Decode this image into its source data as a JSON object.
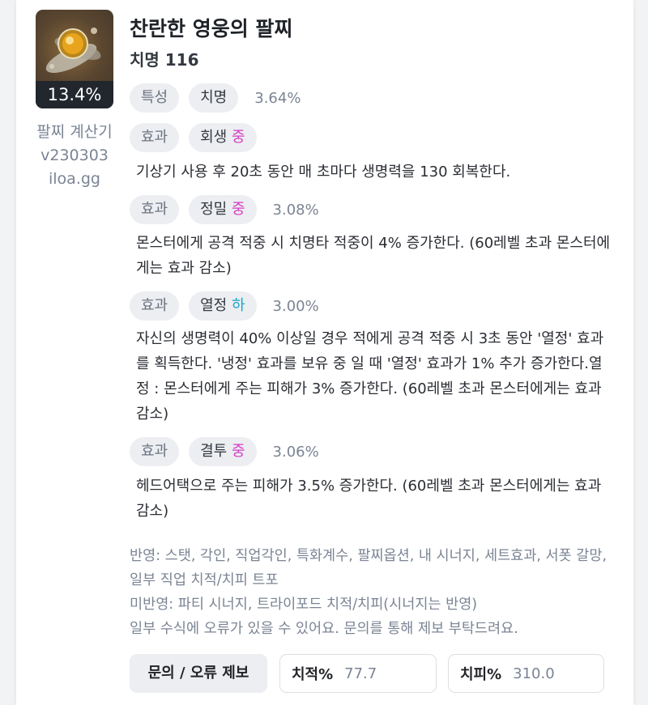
{
  "item": {
    "percent": "13.4%",
    "name": "찬란한 영웅의 팔찌",
    "stat": "치명 116"
  },
  "calculator": {
    "name": "팔찌 계산기",
    "version": "v230303",
    "site": "iloa.gg"
  },
  "trait": {
    "type_label": "특성",
    "stat_label": "치명",
    "value": "3.64%"
  },
  "effects": [
    {
      "type_label": "효과",
      "name": "회생",
      "grade": "중",
      "value": "",
      "description": "기상기 사용 후 20초 동안 매 초마다 생명력을 130 회복한다."
    },
    {
      "type_label": "효과",
      "name": "정밀",
      "grade": "중",
      "value": "3.08%",
      "description": "몬스터에게 공격 적중 시 치명타 적중이 4% 증가한다. (60레벨 초과 몬스터에게는 효과 감소)"
    },
    {
      "type_label": "효과",
      "name": "열정",
      "grade": "하",
      "value": "3.00%",
      "description": "자신의 생명력이 40% 이상일 경우 적에게 공격 적중 시 3초 동안 '열정' 효과를 획득한다. '냉정' 효과를 보유 중 일 때 '열정' 효과가 1% 추가 증가한다.열정 : 몬스터에게 주는 피해가 3% 증가한다. (60레벨 초과 몬스터에게는 효과 감소)"
    },
    {
      "type_label": "효과",
      "name": "결투",
      "grade": "중",
      "value": "3.06%",
      "description": "헤드어택으로 주는 피해가 3.5% 증가한다. (60레벨 초과 몬스터에게는 효과 감소)"
    }
  ],
  "notes": {
    "applied": "반영: 스탯, 각인, 직업각인, 특화계수, 팔찌옵션, 내 시너지, 세트효과, 서폿 갈망, 일부 직업 치적/치피 트포",
    "not_applied": "미반영: 파티 시너지, 트라이포드 치적/치피(시너지는 반영)",
    "disclaimer": "일부 수식에 오류가 있을 수 있어요. 문의를 통해 제보 부탁드려요."
  },
  "controls": {
    "report_button": "문의 / 오류 제보",
    "crit_rate_label": "치적%",
    "crit_rate_value": "77.7",
    "crit_dmg_label": "치피%",
    "crit_dmg_value": "310.0"
  },
  "colors": {
    "grade_mid": "#d63bc4",
    "grade_low": "#1aa6c7",
    "pill_bg": "#eceef1",
    "muted_text": "#7b8494"
  },
  "icons": {
    "item_image": "bracelet-icon"
  }
}
